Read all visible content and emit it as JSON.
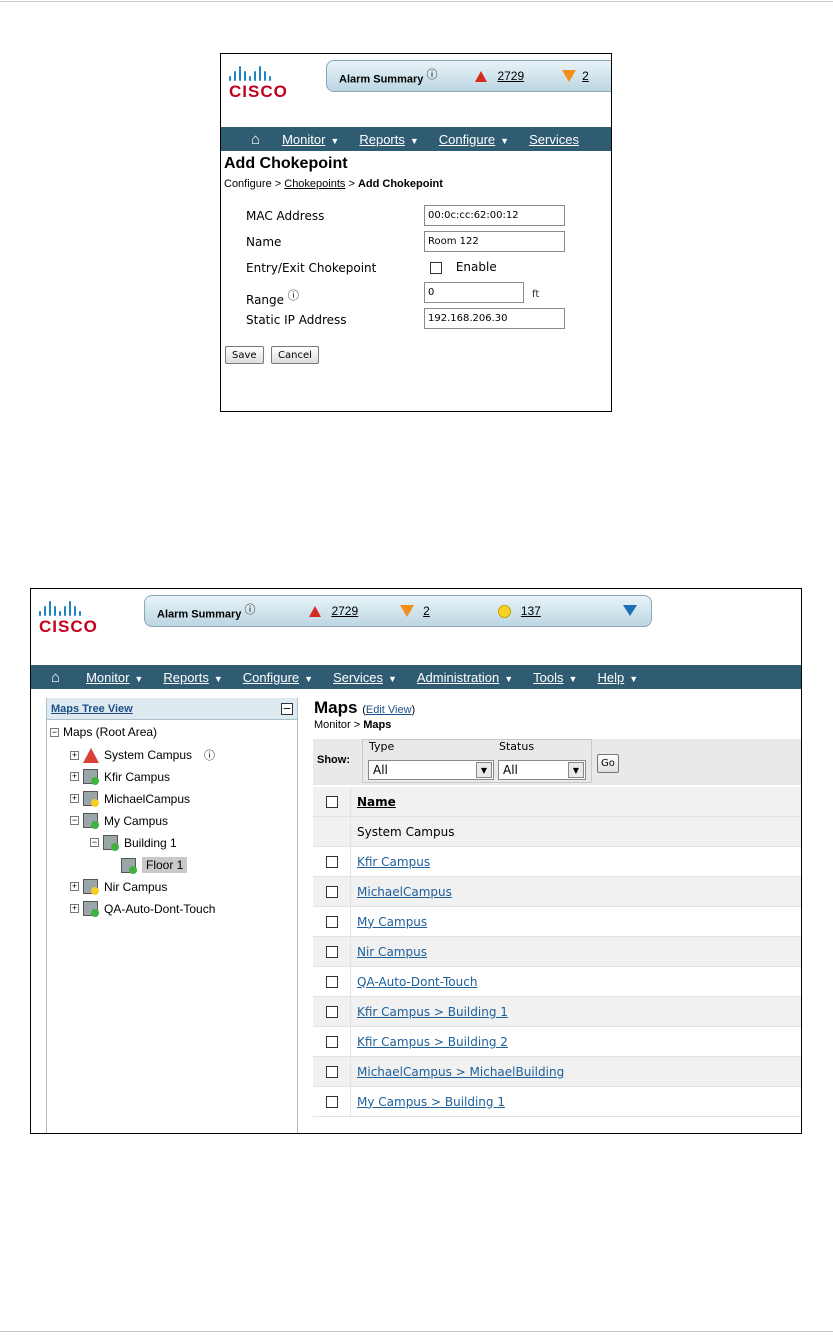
{
  "top": {
    "logo_text": "CISCO",
    "alarm_label": "Alarm Summary",
    "critical_count": "2729",
    "major_count_partial": "2",
    "nav": {
      "home": "⌂",
      "items": [
        "Monitor",
        "Reports",
        "Configure",
        "Services"
      ]
    },
    "title": "Add Chokepoint",
    "breadcrumb": {
      "first": "Configure",
      "link": "Chokepoints",
      "current": "Add Chokepoint"
    },
    "fields": {
      "mac_label": "MAC Address",
      "mac_value": "00:0c:cc:62:00:12",
      "name_label": "Name",
      "name_value": "Room 122",
      "entry_label": "Entry/Exit Chokepoint",
      "enable_label": "Enable",
      "range_label": "Range",
      "range_value": "0",
      "range_unit": "ft",
      "ip_label": "Static IP Address",
      "ip_value": "192.168.206.30"
    },
    "save": "Save",
    "cancel": "Cancel"
  },
  "bottom": {
    "logo_text": "CISCO",
    "alarm_label": "Alarm Summary",
    "critical_count": "2729",
    "major_count": "2",
    "minor_count": "137",
    "nav": [
      "Monitor",
      "Reports",
      "Configure",
      "Services",
      "Administration",
      "Tools",
      "Help"
    ],
    "tree": {
      "header": "Maps Tree View",
      "root": "Maps (Root Area)",
      "nodes": [
        "System Campus",
        "Kfir Campus",
        "MichaelCampus",
        "My Campus",
        "Building 1",
        "Floor 1",
        "Nir Campus",
        "QA-Auto-Dont-Touch"
      ]
    },
    "main": {
      "title": "Maps",
      "edit_view": "Edit View",
      "breadcrumb_first": "Monitor",
      "breadcrumb_current": "Maps",
      "show_label": "Show:",
      "type_label": "Type",
      "type_value": "All",
      "status_label": "Status",
      "status_value": "All",
      "go": "Go",
      "name_header": "Name",
      "rows": [
        "System Campus",
        "Kfir Campus",
        "MichaelCampus",
        "My Campus",
        "Nir Campus",
        "QA-Auto-Dont-Touch",
        "Kfir Campus > Building 1",
        "Kfir Campus > Building 2",
        "MichaelCampus > MichaelBuilding",
        "My Campus > Building 1"
      ]
    }
  }
}
